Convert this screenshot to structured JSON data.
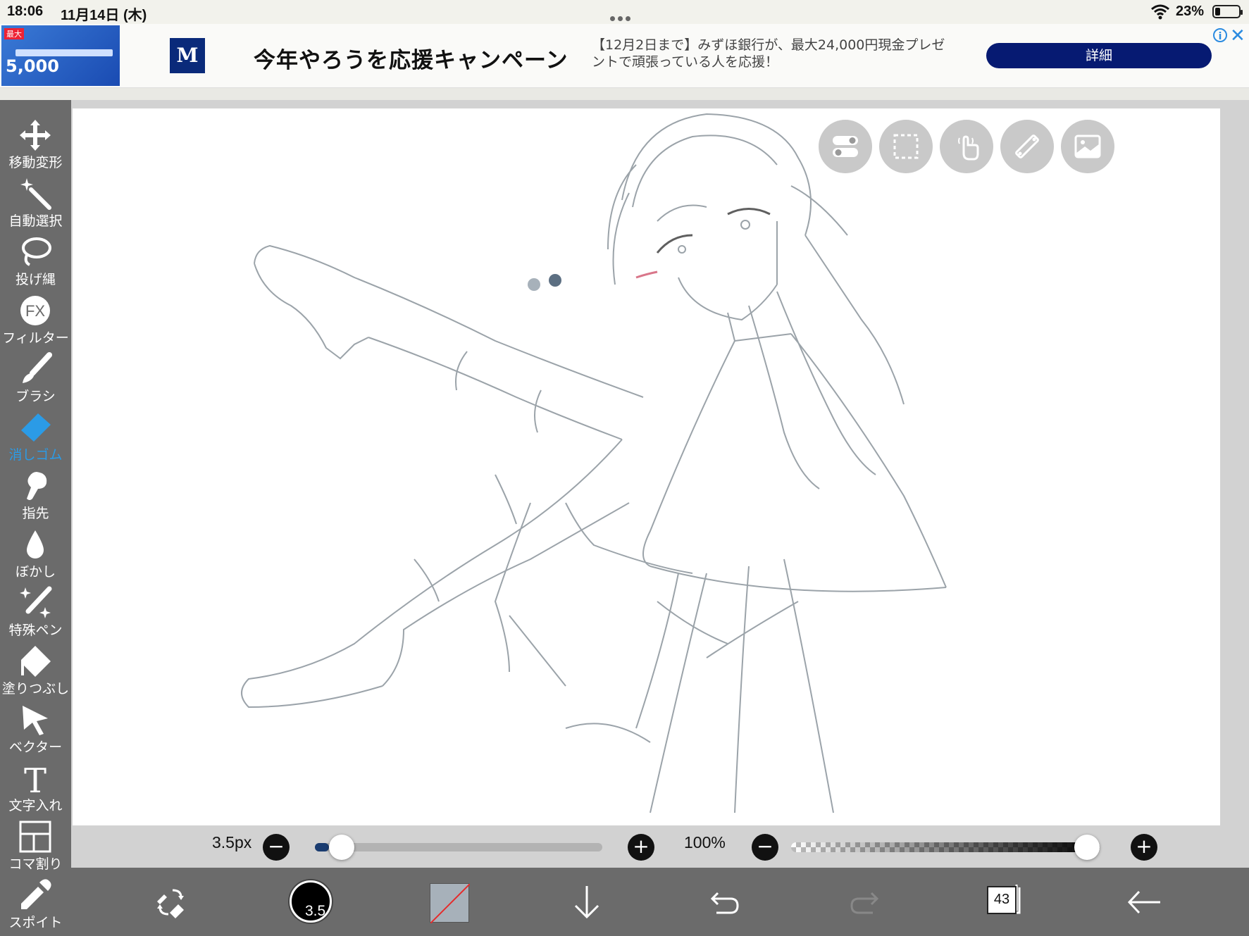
{
  "status_bar": {
    "time": "18:06",
    "date": "11月14日 (木)",
    "battery": "23%",
    "battery_level": 0.23
  },
  "ad": {
    "thumb_tag": "最大5,000",
    "thumb_amount": "5,000",
    "logo": "M",
    "title": "今年やろうを応援キャンペーン",
    "description": "【12月2日まで】みずほ銀行が、最大24,000円現金プレゼントで頑張っている人を応援！",
    "button": "詳細",
    "info": "i",
    "close": "✕"
  },
  "tools": [
    {
      "id": "move",
      "label": "移動変形",
      "icon": "move-icon"
    },
    {
      "id": "auto-select",
      "label": "自動選択",
      "icon": "magic-wand-icon"
    },
    {
      "id": "lasso",
      "label": "投げ縄",
      "icon": "lasso-icon"
    },
    {
      "id": "filter",
      "label": "フィルター",
      "icon": "fx-icon"
    },
    {
      "id": "brush",
      "label": "ブラシ",
      "icon": "brush-icon"
    },
    {
      "id": "eraser",
      "label": "消しゴム",
      "icon": "eraser-icon",
      "active": true
    },
    {
      "id": "finger",
      "label": "指先",
      "icon": "finger-icon"
    },
    {
      "id": "blur",
      "label": "ぼかし",
      "icon": "drop-icon"
    },
    {
      "id": "special-pen",
      "label": "特殊ペン",
      "icon": "sparkle-pen-icon"
    },
    {
      "id": "fill",
      "label": "塗りつぶし",
      "icon": "fill-icon"
    },
    {
      "id": "vector",
      "label": "ベクター",
      "icon": "cursor-icon"
    },
    {
      "id": "text",
      "label": "文字入れ",
      "icon": "text-icon"
    },
    {
      "id": "panel",
      "label": "コマ割り",
      "icon": "panel-icon"
    },
    {
      "id": "eyedropper",
      "label": "スポイト",
      "icon": "eyedropper-icon"
    }
  ],
  "sliders": {
    "brush_size": "3.5px",
    "brush_size_fraction": 0.05,
    "opacity": "100%",
    "opacity_fraction": 1.0,
    "minus": "−",
    "plus": "+"
  },
  "bottom_bar": {
    "brush_size": "3.5",
    "layer_count": "43"
  },
  "colors": {
    "toolbar": "#6b6b6b",
    "active_tool": "#2b9be6",
    "ad_button": "#061a72",
    "current_color": "#a7b1ba"
  }
}
